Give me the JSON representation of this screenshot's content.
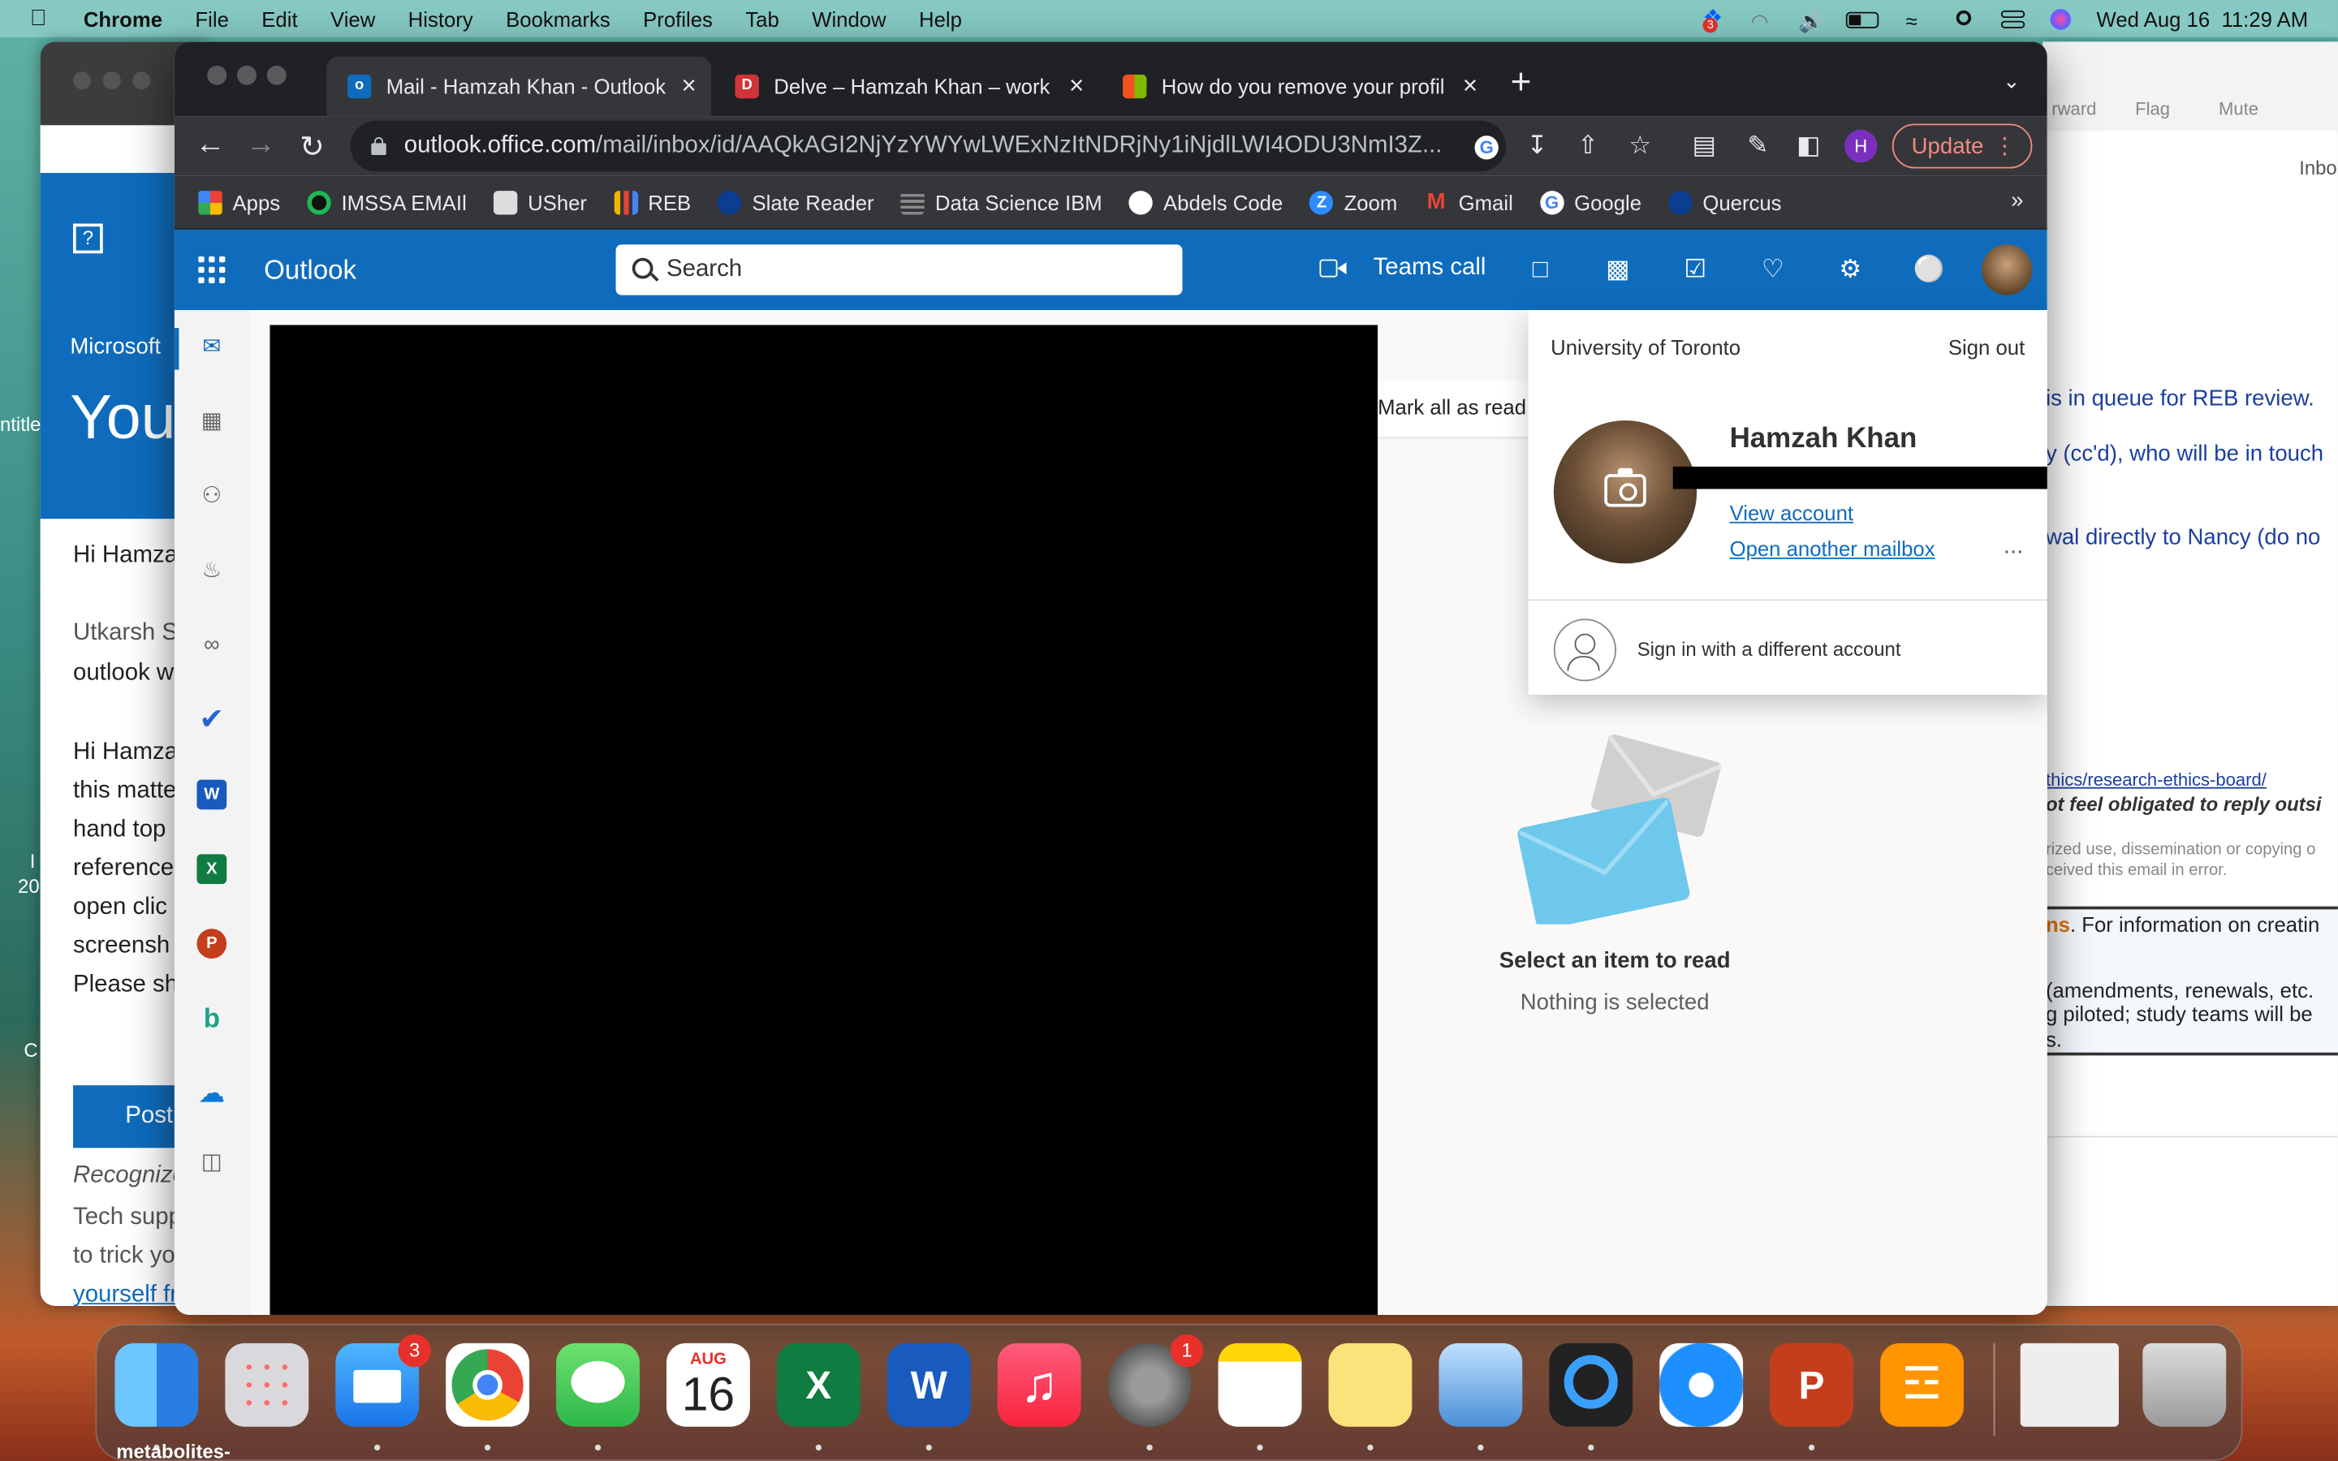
{
  "menubar": {
    "app": "Chrome",
    "items": [
      "File",
      "Edit",
      "View",
      "History",
      "Bookmarks",
      "Profiles",
      "Tab",
      "Window",
      "Help"
    ],
    "clock": "Wed Aug 16  11:29 AM",
    "dropbox_badge": "3"
  },
  "bg_left_window": {
    "brand": "Microsoft",
    "heading": "You",
    "greeting": "Hi Hamza",
    "line1": "Utkarsh S",
    "line2": "outlook w",
    "para": [
      "Hi Hamza",
      "this matte",
      "hand top",
      "reference",
      "open clic",
      "screensh",
      "Please sh"
    ],
    "post_button": "Post",
    "recognize": "Recognize",
    "tech": "Tech supp",
    "trick": "to trick yo",
    "yourself": "yourself fr"
  },
  "bg_right_window": {
    "toolbar": [
      "rward",
      "Flag",
      "Mute"
    ],
    "inbox": "Inbo",
    "lines": [
      "is in queue for REB review.",
      "y (cc'd), who will be in touch",
      "wal directly to Nancy (do no"
    ],
    "link": "thics/research-ethics-board/",
    "italic": "ot feel obligated to reply outsi",
    "fine1": "rized use, dissemination or copying o",
    "fine2": "ceived this email in error.",
    "ns_highlight": "ns",
    "info": ". For information on creatin",
    "amend": "(amendments, renewals, etc.",
    "piloted": "g piloted; study teams will be",
    "s_end": "s."
  },
  "desktop": {
    "label_untitled": "ntitle",
    "label_i": "I",
    "label_20": "20",
    "label_c": "C",
    "below_dock": "metabolites-"
  },
  "tabs": [
    {
      "title": "Mail - Hamzah Khan - Outlook",
      "active": true,
      "favicon": "outlook-icon",
      "color": "#0f6cbd"
    },
    {
      "title": "Delve – Hamzah Khan – work",
      "active": false,
      "favicon": "delve-icon",
      "color": "#d13438"
    },
    {
      "title": "How do you remove your profil",
      "active": false,
      "favicon": "microsoft-icon",
      "color": "#f25022"
    }
  ],
  "address": {
    "host": "outlook.office.com",
    "path": "/mail/inbox/id/AAQkAGI2NjYzYWYwLWExNzItNDRjNy1iNjdlLWI4ODU3NmI3Z..."
  },
  "chrome_toolbar": {
    "profile_letter": "H",
    "update_label": "Update"
  },
  "bookmarks": [
    {
      "label": "Apps",
      "icon": "apps-grid-icon",
      "color": "#ea4335"
    },
    {
      "label": "IMSSA EMAIl",
      "icon": "imssa-icon",
      "color": "#1db954"
    },
    {
      "label": "USher",
      "icon": "usher-doc-icon",
      "color": "#dddddd"
    },
    {
      "label": "REB",
      "icon": "reb-chart-icon",
      "color": "#f4b400"
    },
    {
      "label": "Slate Reader",
      "icon": "slate-icon",
      "color": "#0b3d91"
    },
    {
      "label": "Data Science IBM",
      "icon": "ibm-icon",
      "color": "#888888"
    },
    {
      "label": "Abdels Code",
      "icon": "github-icon",
      "color": "#ffffff"
    },
    {
      "label": "Zoom",
      "icon": "zoom-icon",
      "color": "#2d8cff"
    },
    {
      "label": "Gmail",
      "icon": "gmail-icon",
      "color": "#ea4335"
    },
    {
      "label": "Google",
      "icon": "google-icon",
      "color": "#4285f4"
    },
    {
      "label": "Quercus",
      "icon": "quercus-icon",
      "color": "#0b3d91"
    }
  ],
  "outlook": {
    "app_name": "Outlook",
    "search_placeholder": "Search",
    "teams_call": "Teams call",
    "mark_all_read": "Mark all as read",
    "empty_title": "Select an item to read",
    "empty_sub": "Nothing is selected",
    "brand_color": "#0f6cbd"
  },
  "account": {
    "org": "University of Toronto",
    "sign_out": "Sign out",
    "name": "Hamzah Khan",
    "view_account": "View account",
    "open_mailbox": "Open another mailbox",
    "more": "...",
    "sign_in_different": "Sign in with a different account"
  },
  "dock": {
    "calendar_month": "AUG",
    "calendar_day": "16",
    "mail_badge": "3",
    "settings_badge": "1"
  }
}
